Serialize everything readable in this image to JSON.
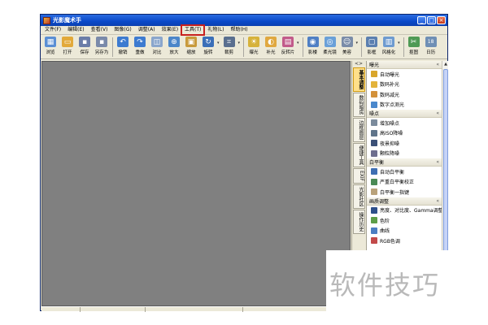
{
  "window": {
    "title": "光影魔术手",
    "min": "_",
    "max": "□",
    "close": "×"
  },
  "menu": [
    {
      "label": "文件(F)",
      "highlight": false
    },
    {
      "label": "编辑(E)",
      "highlight": false
    },
    {
      "label": "查看(V)",
      "highlight": false
    },
    {
      "label": "图像(G)",
      "highlight": false
    },
    {
      "label": "调整(A)",
      "highlight": false
    },
    {
      "label": "效果(E)",
      "highlight": false
    },
    {
      "label": "工具(T)",
      "highlight": true
    },
    {
      "label": "礼物(L)",
      "highlight": false
    },
    {
      "label": "帮助(H)",
      "highlight": false
    }
  ],
  "toolbar": [
    {
      "label": "浏览",
      "icon": "browse-icon",
      "color": "#5b8fd4",
      "glyph": "▦"
    },
    {
      "label": "打开",
      "icon": "open-folder-icon",
      "color": "#e2a93a",
      "glyph": "▭"
    },
    {
      "label": "保存",
      "icon": "save-icon",
      "color": "#6b7da8",
      "glyph": "▪"
    },
    {
      "label": "另存为",
      "icon": "save-as-icon",
      "color": "#7a8aaa",
      "glyph": "▪"
    },
    {
      "sep": true
    },
    {
      "label": "撤销",
      "icon": "undo-icon",
      "color": "#3d7bd0",
      "glyph": "↶"
    },
    {
      "label": "重做",
      "icon": "redo-icon",
      "color": "#3d7bd0",
      "glyph": "↷"
    },
    {
      "label": "对比",
      "icon": "compare-icon",
      "color": "#8aa6cc",
      "glyph": "◫"
    },
    {
      "label": "放大",
      "icon": "zoom-in-icon",
      "color": "#4b86c9",
      "glyph": "⊕"
    },
    {
      "label": "缩放",
      "icon": "resize-icon",
      "color": "#c89a3c",
      "glyph": "▣"
    },
    {
      "label": "旋转",
      "icon": "rotate-icon",
      "color": "#3b6fb8",
      "glyph": "↻",
      "dropdown": true
    },
    {
      "label": "裁剪",
      "icon": "crop-icon",
      "color": "#5a6f8f",
      "glyph": "⌗",
      "dropdown": true
    },
    {
      "sep": true
    },
    {
      "label": "曝光",
      "icon": "exposure-icon",
      "color": "#d6b23a",
      "glyph": "☀"
    },
    {
      "label": "补光",
      "icon": "fill-light-icon",
      "color": "#e0a840",
      "glyph": "◐"
    },
    {
      "label": "反转片",
      "icon": "reversal-film-icon",
      "color": "#c25b8a",
      "glyph": "▤",
      "dropdown": true
    },
    {
      "sep": true
    },
    {
      "label": "影楼",
      "icon": "studio-icon",
      "color": "#4f7fc4",
      "glyph": "◉"
    },
    {
      "label": "柔光镜",
      "icon": "soft-light-icon",
      "color": "#6aa0d8",
      "glyph": "◎"
    },
    {
      "label": "美容",
      "icon": "beauty-icon",
      "color": "#7a8ca8",
      "glyph": "☺",
      "dropdown": true
    },
    {
      "sep": true
    },
    {
      "label": "影框",
      "icon": "photo-frame-icon",
      "color": "#5b7fb0",
      "glyph": "▢"
    },
    {
      "label": "风格化",
      "icon": "stylize-icon",
      "color": "#6e9bd0",
      "glyph": "▥",
      "dropdown": true
    },
    {
      "sep": true
    },
    {
      "label": "抠图",
      "icon": "cutout-icon",
      "color": "#4f9a55",
      "glyph": "✂"
    },
    {
      "label": "日历",
      "icon": "calendar-icon",
      "color": "#6f8fb5",
      "glyph": "18"
    }
  ],
  "side_tabs": [
    {
      "label": "基本调整",
      "active": true
    },
    {
      "label": "数码暗房",
      "active": false
    },
    {
      "label": "边框图层",
      "active": false
    },
    {
      "label": "便捷工具",
      "active": false
    },
    {
      "label": "EXIF",
      "active": false
    },
    {
      "label": "光影社区",
      "active": false
    },
    {
      "label": "操作历史",
      "active": false
    }
  ],
  "side_expand": "<>",
  "panel_groups": [
    {
      "title": "曝光",
      "items": [
        {
          "label": "自动曝光",
          "icon": "auto-exposure-icon",
          "color": "#d9a62b"
        },
        {
          "label": "数码补光",
          "icon": "digital-fill-light-icon",
          "color": "#e3b33b"
        },
        {
          "label": "数码减光",
          "icon": "digital-dim-light-icon",
          "color": "#d3913a"
        },
        {
          "label": "数字点测光",
          "icon": "spot-metering-icon",
          "color": "#4a88cc"
        }
      ]
    },
    {
      "title": "噪点",
      "items": [
        {
          "label": "增加噪点",
          "icon": "add-noise-icon",
          "color": "#7b8b9c"
        },
        {
          "label": "高ISO降噪",
          "icon": "high-iso-denoise-icon",
          "color": "#5f748a"
        },
        {
          "label": "夜景抑噪",
          "icon": "night-denoise-icon",
          "color": "#3b5077"
        },
        {
          "label": "颗粒降噪",
          "icon": "grain-denoise-icon",
          "color": "#6e6e8e"
        }
      ]
    },
    {
      "title": "白平衡",
      "items": [
        {
          "label": "自动白平衡",
          "icon": "auto-white-balance-icon",
          "color": "#3e6fb3"
        },
        {
          "label": "严重白平衡校正",
          "icon": "white-balance-correction-icon",
          "color": "#4a8a55"
        },
        {
          "label": "白平衡一指键",
          "icon": "white-balance-one-touch-icon",
          "color": "#b9a27a"
        }
      ]
    },
    {
      "title": "画质调整",
      "items": [
        {
          "label": "亮度、对比度、Gamma调整",
          "icon": "brightness-contrast-icon",
          "color": "#2d4f8a"
        },
        {
          "label": "色阶",
          "icon": "levels-icon",
          "color": "#5d9e48"
        },
        {
          "label": "曲线",
          "icon": "curves-icon",
          "color": "#4c7ec2"
        },
        {
          "label": "RGB色调",
          "icon": "rgb-tone-icon",
          "color": "#c24a4a"
        }
      ]
    }
  ],
  "scroll": {
    "up": "▲",
    "down": "▼"
  },
  "chev": "«",
  "watermark": "软件技巧"
}
